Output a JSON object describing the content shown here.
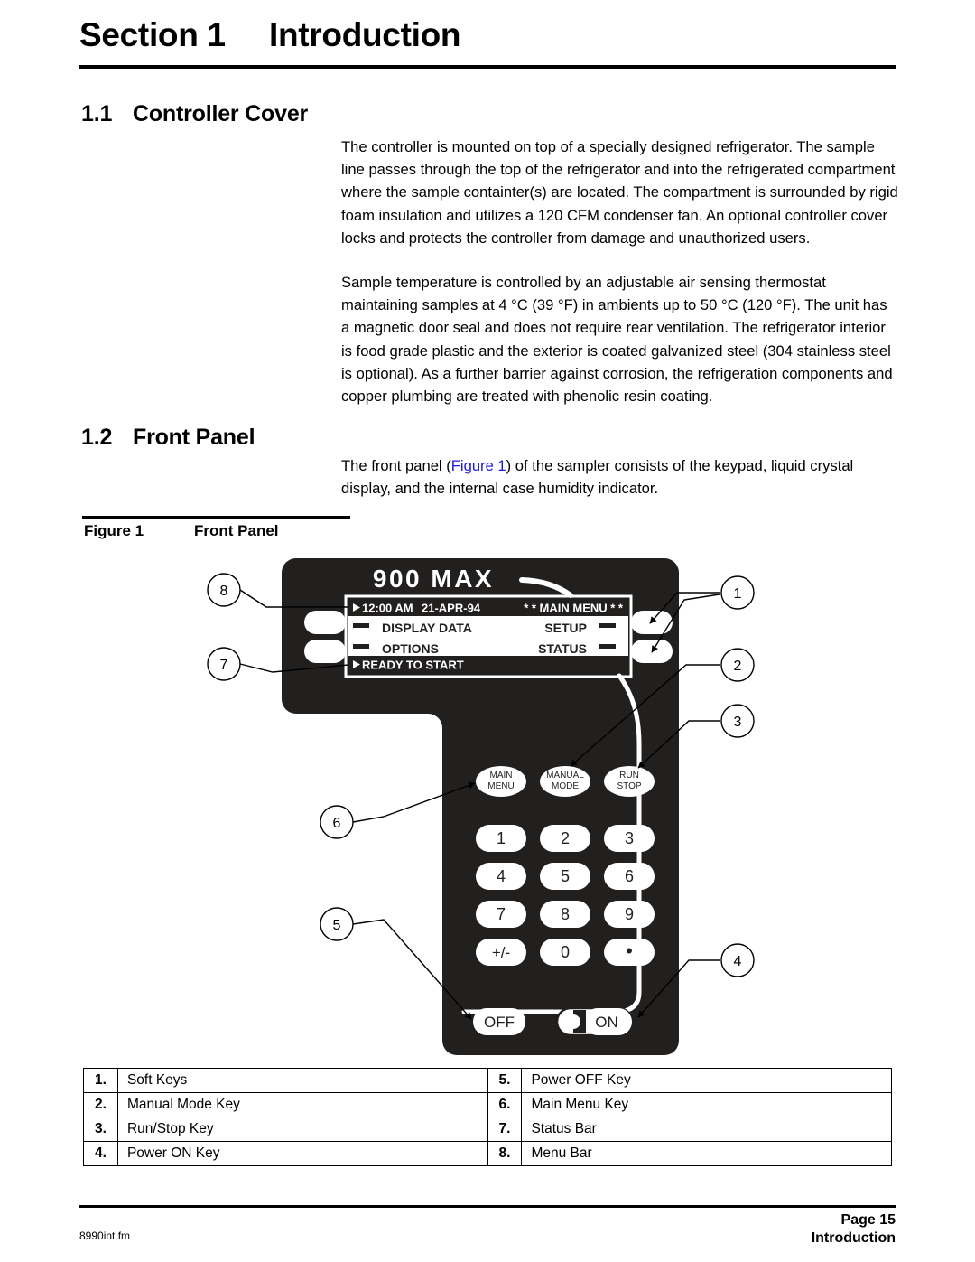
{
  "section": {
    "label": "Section 1",
    "title": "Introduction"
  },
  "headings": {
    "h11_num": "1.1",
    "h11_text": "Controller Cover",
    "h12_num": "1.2",
    "h12_text": "Front Panel"
  },
  "paragraphs": {
    "p1": "The controller is mounted on top of a specially designed refrigerator. The sample line passes through the top of the refrigerator and into the refrigerated compartment where the sample containter(s) are located. The compartment is surrounded by rigid foam insulation and utilizes a 120 CFM condenser fan. An optional controller cover locks and protects the controller from damage and unauthorized users.",
    "p2": "Sample temperature is controlled by an adjustable air sensing thermostat maintaining samples at 4 °C (39 °F) in ambients up to 50 °C (120 °F). The unit has a magnetic door seal and does not require rear ventilation. The refrigerator interior is food grade plastic and the exterior is coated galvanized steel (304 stainless steel is optional). As a further barrier against corrosion, the refrigeration components and copper plumbing are treated with phenolic resin coating.",
    "p3_before": "The front panel (",
    "p3_link": "Figure 1",
    "p3_after": ") of the sampler consists of the keypad, liquid crystal display, and the internal case humidity indicator."
  },
  "figure": {
    "caption_num": "Figure 1",
    "caption_text": "Front Panel",
    "brand": "900 MAX",
    "lcd": {
      "time": "12:00 AM",
      "date": "21-APR-94",
      "title": "* * MAIN MENU * *",
      "left_top": "DISPLAY DATA",
      "right_top": "SETUP",
      "left_bottom": "OPTIONS",
      "right_bottom": "STATUS",
      "status": "READY TO START"
    },
    "function_keys": [
      {
        "line1": "MAIN",
        "line2": "MENU"
      },
      {
        "line1": "MANUAL",
        "line2": "MODE"
      },
      {
        "line1": "RUN",
        "line2": "STOP"
      }
    ],
    "keypad": [
      "1",
      "2",
      "3",
      "4",
      "5",
      "6",
      "7",
      "8",
      "9",
      "+/-",
      "0",
      "•"
    ],
    "power_off": "OFF",
    "power_on": "ON",
    "callouts": [
      "1",
      "2",
      "3",
      "4",
      "5",
      "6",
      "7",
      "8"
    ],
    "panel_color": "#221f1f"
  },
  "legend": {
    "rows": [
      {
        "n1": "1.",
        "l1": "Soft Keys",
        "n2": "5.",
        "l2": "Power OFF Key"
      },
      {
        "n1": "2.",
        "l1": "Manual Mode Key",
        "n2": "6.",
        "l2": "Main Menu Key"
      },
      {
        "n1": "3.",
        "l1": "Run/Stop Key",
        "n2": "7.",
        "l2": "Status Bar"
      },
      {
        "n1": "4.",
        "l1": "Power ON Key",
        "n2": "8.",
        "l2": "Menu Bar"
      }
    ]
  },
  "footer": {
    "file": "8990int.fm",
    "page": "Page 15",
    "chapter": "Introduction"
  }
}
